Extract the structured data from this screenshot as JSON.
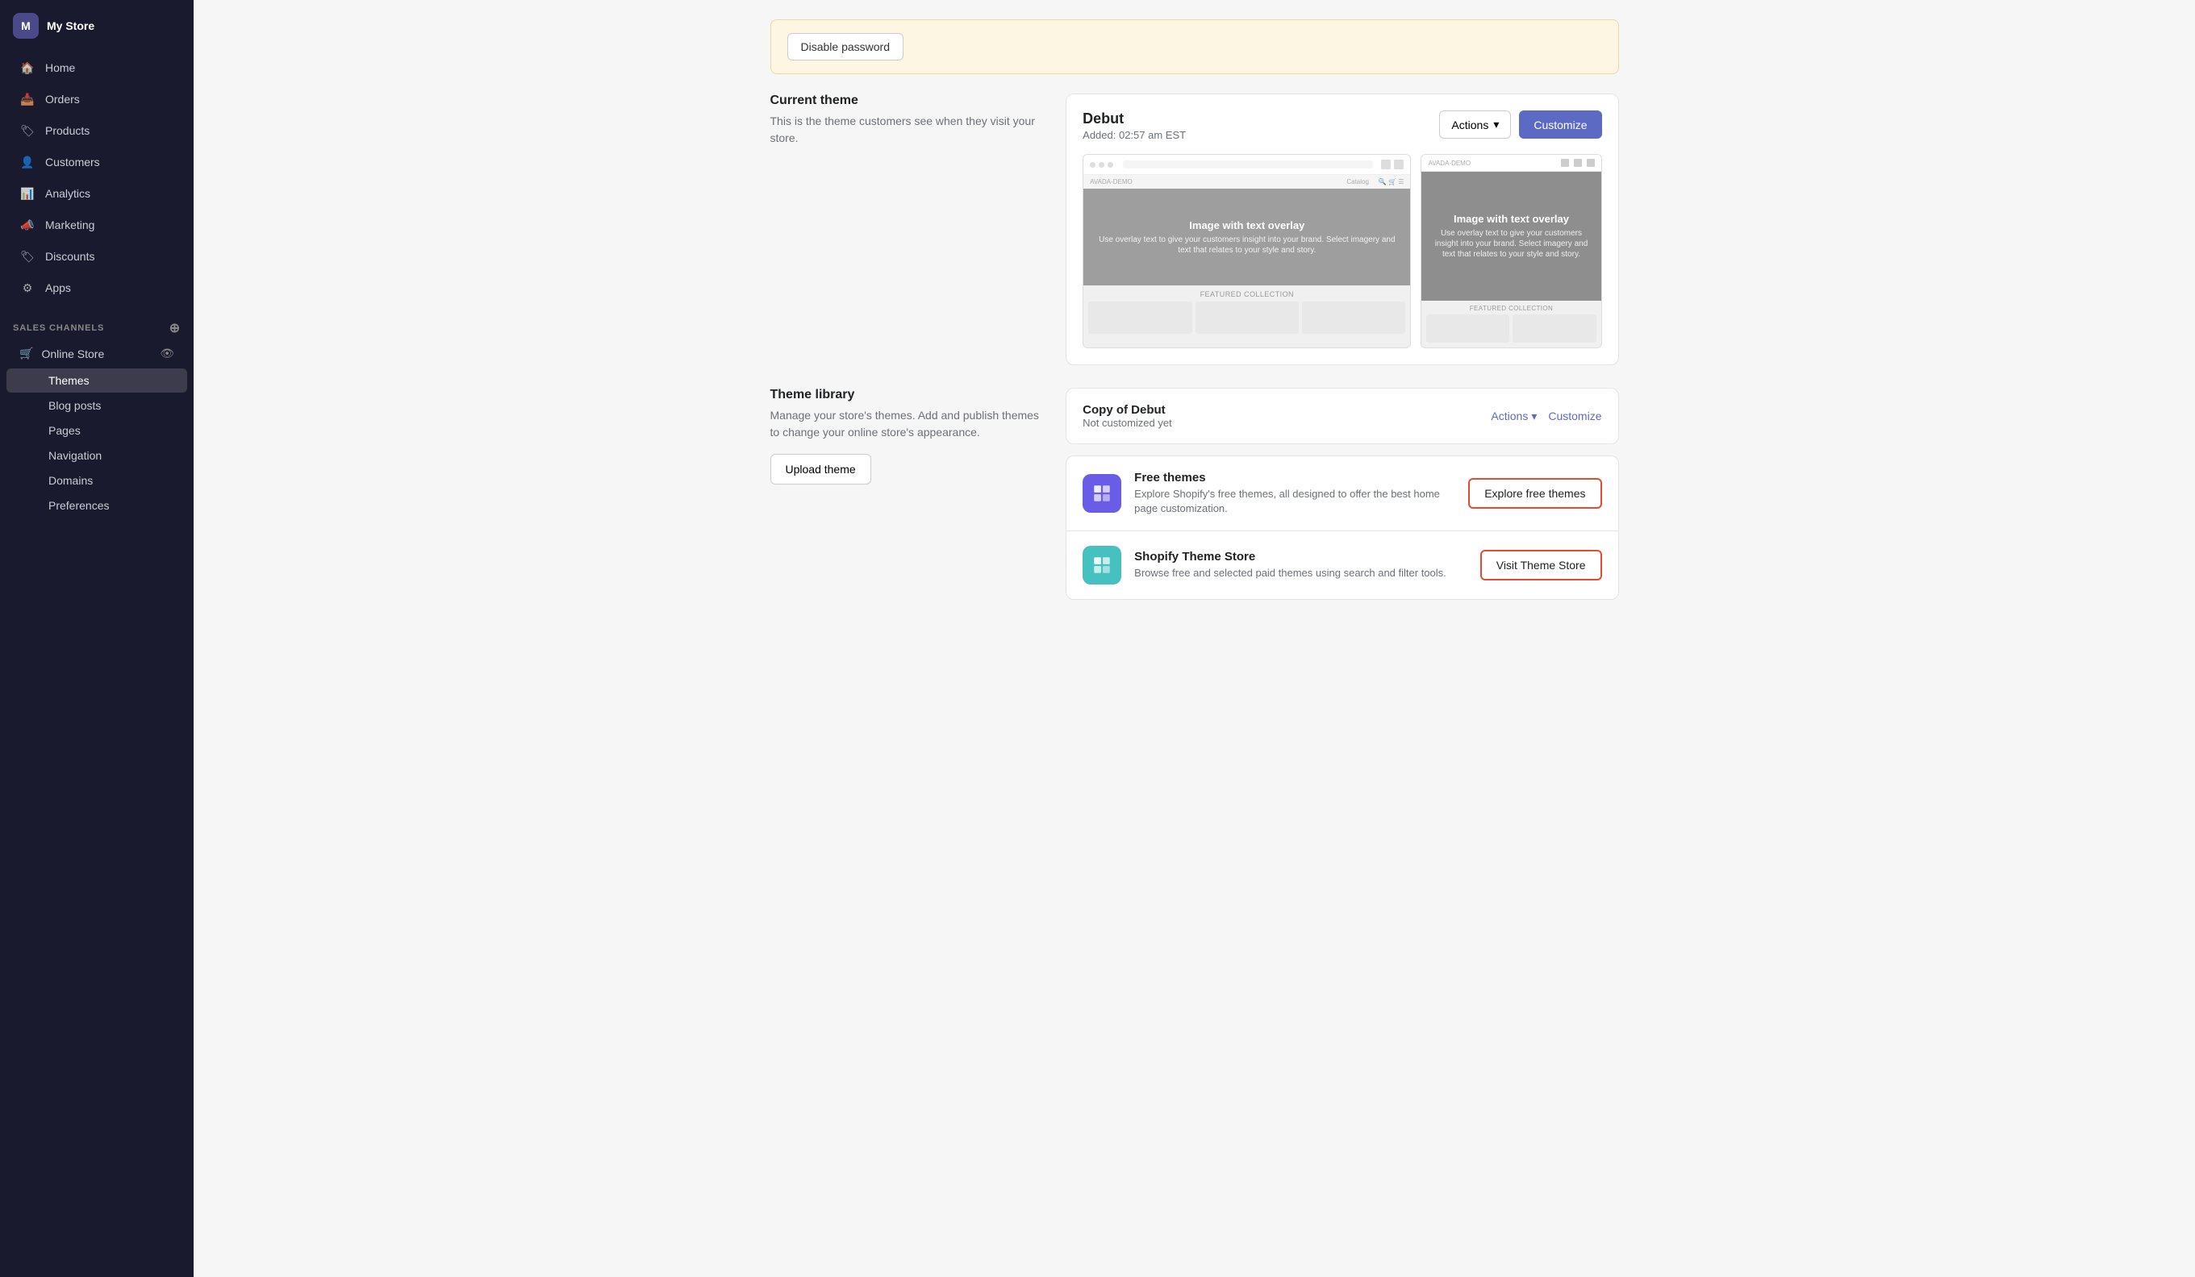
{
  "sidebar": {
    "store_name": "My Store",
    "nav_items": [
      {
        "id": "home",
        "label": "Home",
        "icon": "🏠"
      },
      {
        "id": "orders",
        "label": "Orders",
        "icon": "📥"
      },
      {
        "id": "products",
        "label": "Products",
        "icon": "🏷"
      },
      {
        "id": "customers",
        "label": "Customers",
        "icon": "👤"
      },
      {
        "id": "analytics",
        "label": "Analytics",
        "icon": "📊"
      },
      {
        "id": "marketing",
        "label": "Marketing",
        "icon": "📣"
      },
      {
        "id": "discounts",
        "label": "Discounts",
        "icon": "🏷"
      },
      {
        "id": "apps",
        "label": "Apps",
        "icon": "⚙"
      }
    ],
    "sales_channels_label": "Sales Channels",
    "online_store_label": "Online Store",
    "sub_nav": [
      {
        "id": "themes",
        "label": "Themes",
        "active": true
      },
      {
        "id": "blog-posts",
        "label": "Blog posts"
      },
      {
        "id": "pages",
        "label": "Pages"
      },
      {
        "id": "navigation",
        "label": "Navigation"
      },
      {
        "id": "domains",
        "label": "Domains"
      },
      {
        "id": "preferences",
        "label": "Preferences"
      }
    ]
  },
  "banner": {
    "disable_password_label": "Disable password"
  },
  "current_theme": {
    "section_title": "Current theme",
    "section_desc": "This is the theme customers see when they visit your store.",
    "theme_name": "Debut",
    "added_date": "Added: 02:57 am EST",
    "actions_label": "Actions",
    "customize_label": "Customize",
    "hero_title": "Image with text overlay",
    "hero_sub": "Use overlay text to give your customers insight into your brand. Select imagery and text that relates to your style and story.",
    "featured_label": "FEATURED COLLECTION",
    "mobile_featured_label": "FEATURED COLLECTION"
  },
  "theme_library": {
    "section_title": "Theme library",
    "section_desc": "Manage your store's themes. Add and publish themes to change your online store's appearance.",
    "upload_theme_label": "Upload theme",
    "copy_theme_name": "Copy of Debut",
    "copy_theme_status": "Not customized yet",
    "copy_actions_label": "Actions",
    "copy_customize_label": "Customize",
    "free_themes_title": "Free themes",
    "free_themes_desc": "Explore Shopify's free themes, all designed to offer the best home page customization.",
    "explore_free_label": "Explore free themes",
    "shopify_store_title": "Shopify Theme Store",
    "shopify_store_desc": "Browse free and selected paid themes using search and filter tools.",
    "visit_store_label": "Visit Theme Store"
  }
}
